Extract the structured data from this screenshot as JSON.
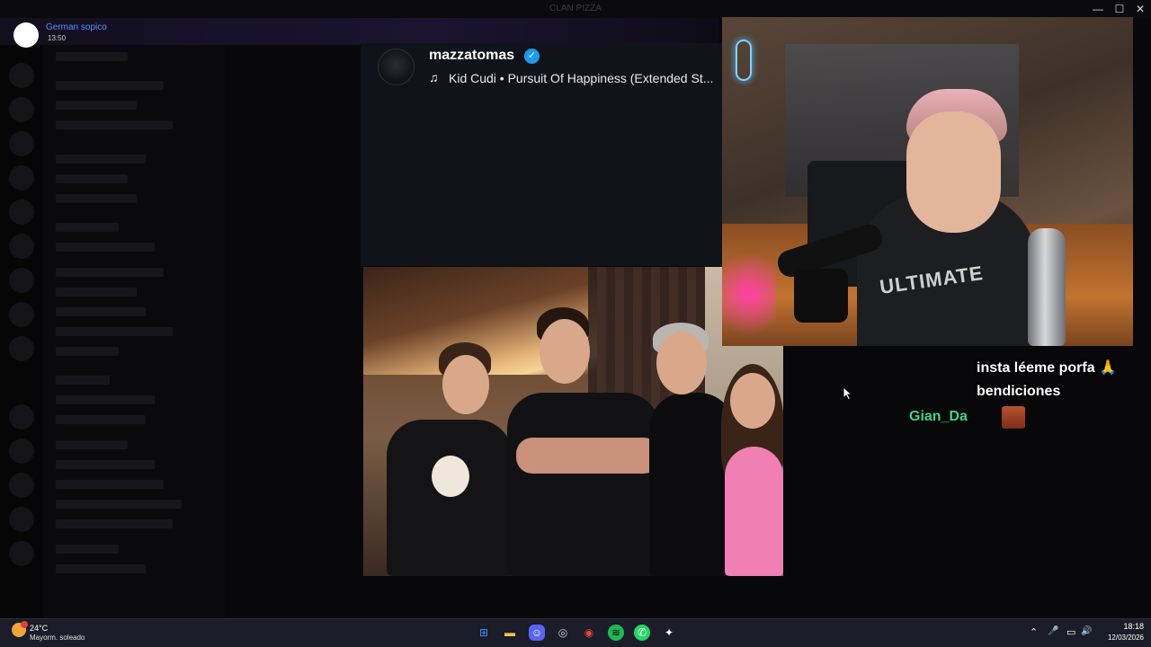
{
  "window": {
    "title": "CLAN PIZZA",
    "minimize_glyph": "—",
    "maximize_glyph": "☐",
    "close_glyph": "✕"
  },
  "notification": {
    "sender": "German sopico",
    "time": "13:50"
  },
  "tweet_media": {
    "username": "mazzatomas",
    "verified_glyph": "✓",
    "music_icon": "♫",
    "track": "Kid Cudi • Pursuit Of Happiness (Extended St..."
  },
  "webcam": {
    "shirt_text": "ULTIMATE"
  },
  "chat": {
    "lines": [
      {
        "text": "insta léeme porfa 🙏"
      },
      {
        "text": "bendiciones"
      }
    ],
    "last_user": "Gian_Da"
  },
  "taskbar": {
    "weather_temp": "24°C",
    "weather_condition": "Mayorm. soleado",
    "apps": [
      {
        "name": "start",
        "glyph": "⊞",
        "color": "#3b8cff"
      },
      {
        "name": "file-explorer",
        "glyph": "▬",
        "color": "#f2c14e"
      },
      {
        "name": "discord",
        "glyph": "☺",
        "color": "#5865f2"
      },
      {
        "name": "steam",
        "glyph": "◎",
        "color": "#2a475e"
      },
      {
        "name": "chrome",
        "glyph": "◉",
        "color": "#e0463a"
      },
      {
        "name": "spotify",
        "glyph": "≋",
        "color": "#1db954"
      },
      {
        "name": "whatsapp",
        "glyph": "✆",
        "color": "#25d366"
      },
      {
        "name": "app-extra",
        "glyph": "✦",
        "color": "#ffffff"
      }
    ],
    "tray_glyphs": [
      "⌃",
      "🎤",
      "▭",
      "🔊"
    ],
    "time": "18:18",
    "date": "12/03/2026"
  }
}
